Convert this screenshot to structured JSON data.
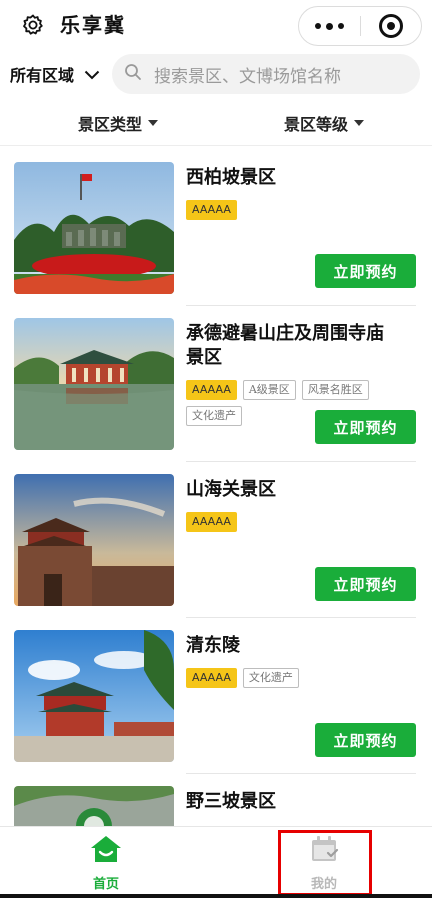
{
  "header": {
    "title": "乐享冀",
    "settings_icon": "gear-icon",
    "more_icon": "more-dots-icon",
    "close_icon": "target-close-icon"
  },
  "search": {
    "region_label": "所有区域",
    "placeholder": "搜索景区、文博场馆名称"
  },
  "filters": {
    "type_label": "景区类型",
    "level_label": "景区等级"
  },
  "colors": {
    "accent_green": "#1aad3a",
    "tag_gold": "#f5c518",
    "highlight_red": "#e60000"
  },
  "scenic_list": [
    {
      "name": "西柏坡景区",
      "tags": [
        {
          "text": "AAAAA",
          "style": "gold"
        }
      ],
      "button": "立即预约"
    },
    {
      "name": "承德避暑山庄及周围寺庙景区",
      "tags": [
        {
          "text": "AAAAA",
          "style": "gold"
        },
        {
          "text": "A级景区",
          "style": "plain"
        },
        {
          "text": "风景名胜区",
          "style": "plain"
        },
        {
          "text": "文化遗产",
          "style": "plain"
        }
      ],
      "button": "立即预约"
    },
    {
      "name": "山海关景区",
      "tags": [
        {
          "text": "AAAAA",
          "style": "gold"
        }
      ],
      "button": "立即预约"
    },
    {
      "name": "清东陵",
      "tags": [
        {
          "text": "AAAAA",
          "style": "gold"
        },
        {
          "text": "文化遗产",
          "style": "plain"
        }
      ],
      "button": "立即预约"
    },
    {
      "name": "野三坡景区",
      "tags": [],
      "button": ""
    }
  ],
  "tabbar": {
    "home_label": "首页",
    "mine_label": "我的"
  }
}
